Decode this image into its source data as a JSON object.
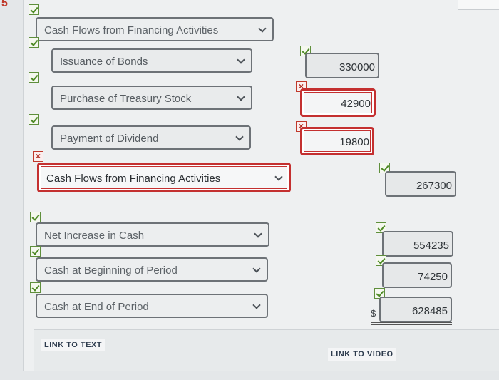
{
  "corner_marker": "5",
  "rows": [
    {
      "id": "header_select",
      "label": "Cash Flows from Financing Activities",
      "status": "correct"
    },
    {
      "id": "issuance",
      "label": "Issuance of Bonds",
      "status": "correct",
      "value": "330000",
      "value_status": "correct"
    },
    {
      "id": "treasury",
      "label": "Purchase of Treasury Stock",
      "status": "correct",
      "value": "42900",
      "value_status": "incorrect"
    },
    {
      "id": "dividend",
      "label": "Payment of Dividend",
      "status": "correct",
      "value": "19800",
      "value_status": "incorrect"
    },
    {
      "id": "total_financing",
      "label": "Cash Flows from Financing Activities",
      "status": "incorrect",
      "value": "267300",
      "value_status": "correct"
    },
    {
      "id": "net_increase",
      "label": "Net Increase in Cash",
      "status": "correct",
      "value": "554235",
      "value_status": "correct"
    },
    {
      "id": "cash_begin",
      "label": "Cash at Beginning of Period",
      "status": "correct",
      "value": "74250",
      "value_status": "correct"
    },
    {
      "id": "cash_end",
      "label": "Cash at End of Period",
      "status": "correct",
      "value": "628485",
      "value_status": "correct",
      "currency": "$"
    }
  ],
  "footer": {
    "link_text": "LINK TO TEXT",
    "link_video": "LINK TO VIDEO"
  },
  "colors": {
    "correct": "#4e8a25",
    "incorrect": "#c43030"
  }
}
